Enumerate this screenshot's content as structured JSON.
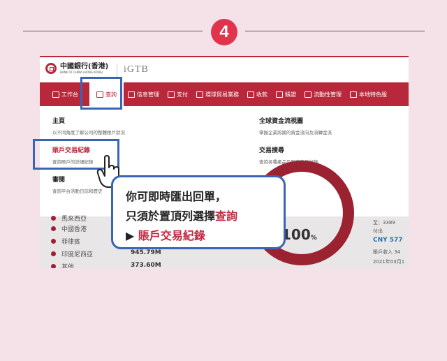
{
  "step": "4",
  "header": {
    "bank_name_cn": "中國銀行(香港)",
    "bank_name_en": "BANK OF CHINA (HONG KONG)",
    "product": "iGTB"
  },
  "nav": {
    "items": [
      {
        "label": "工作台",
        "active": false
      },
      {
        "label": "查詢",
        "active": true
      },
      {
        "label": "信息管理",
        "active": false
      },
      {
        "label": "支付",
        "active": false
      },
      {
        "label": "環球貿易業務",
        "active": false
      },
      {
        "label": "收款",
        "active": false
      },
      {
        "label": "賬證",
        "active": false
      },
      {
        "label": "流動性管理",
        "active": false
      },
      {
        "label": "本地特色服",
        "active": false
      }
    ]
  },
  "menu": {
    "home": {
      "title": "主頁",
      "desc": "以不同角度了解公司的整體賬戶狀況"
    },
    "global_overview": {
      "title": "全球資金流視圖",
      "desc": "掌握企業跨國的資金流向及流轉金流"
    },
    "account_transactions": {
      "title": "賬戶交易紀錄",
      "desc": "查詢賬戶的詳細紀錄"
    },
    "transaction_search": {
      "title": "交易搜尋",
      "desc": "查詢各種產品及服務交易紀錄"
    },
    "audit": {
      "title": "審閱",
      "desc": "查詢平台活動日誌和歷史"
    }
  },
  "dashboard": {
    "rows": [
      {
        "label": "馬來西亞",
        "value": ""
      },
      {
        "label": "中國香港",
        "value": ""
      },
      {
        "label": "菲律賓",
        "value": ""
      },
      {
        "label": "印度尼西亞",
        "value": "945.79M"
      },
      {
        "label": "其他",
        "value": "373.60M"
      }
    ],
    "percent": "100",
    "percent_unit": "%",
    "right": {
      "line1": "至：3389",
      "line2": "付出",
      "cny": "CNY 577",
      "line3": "賬戶收入 34",
      "line4": "2021年03月1"
    }
  },
  "callout": {
    "line1": "你可即時匯出回單，",
    "line2_prefix": "只須於置頂列選擇",
    "line2_highlight": "查詢",
    "line3_arrow": "▶",
    "line3_highlight": "賬戶交易紀錄"
  },
  "colors": {
    "brand_red": "#b8283a",
    "highlight_blue": "#3a64b5",
    "background": "#f5e1e8",
    "step_red": "#e0344d"
  }
}
